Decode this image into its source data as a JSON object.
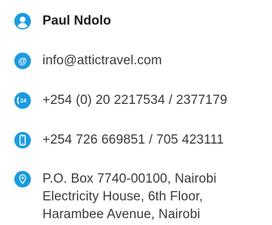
{
  "contact": {
    "icons": {
      "person": "person-icon",
      "email": "at-icon",
      "phone": "phone-24-icon",
      "mobile": "mobile-phone-icon",
      "address": "location-pin-icon"
    },
    "accent_color": "#1a9be0",
    "name": "Paul Ndolo",
    "email": "info@attictravel.com",
    "phone_badge": "24",
    "phone": "+254 (0) 20 2217534 / 2377179",
    "mobile": "+254 726 669851 / 705 423111",
    "address": [
      "P.O. Box 7740-00100, Nairobi",
      "Electricity House, 6th Floor,",
      "Harambee Avenue, Nairobi"
    ]
  }
}
